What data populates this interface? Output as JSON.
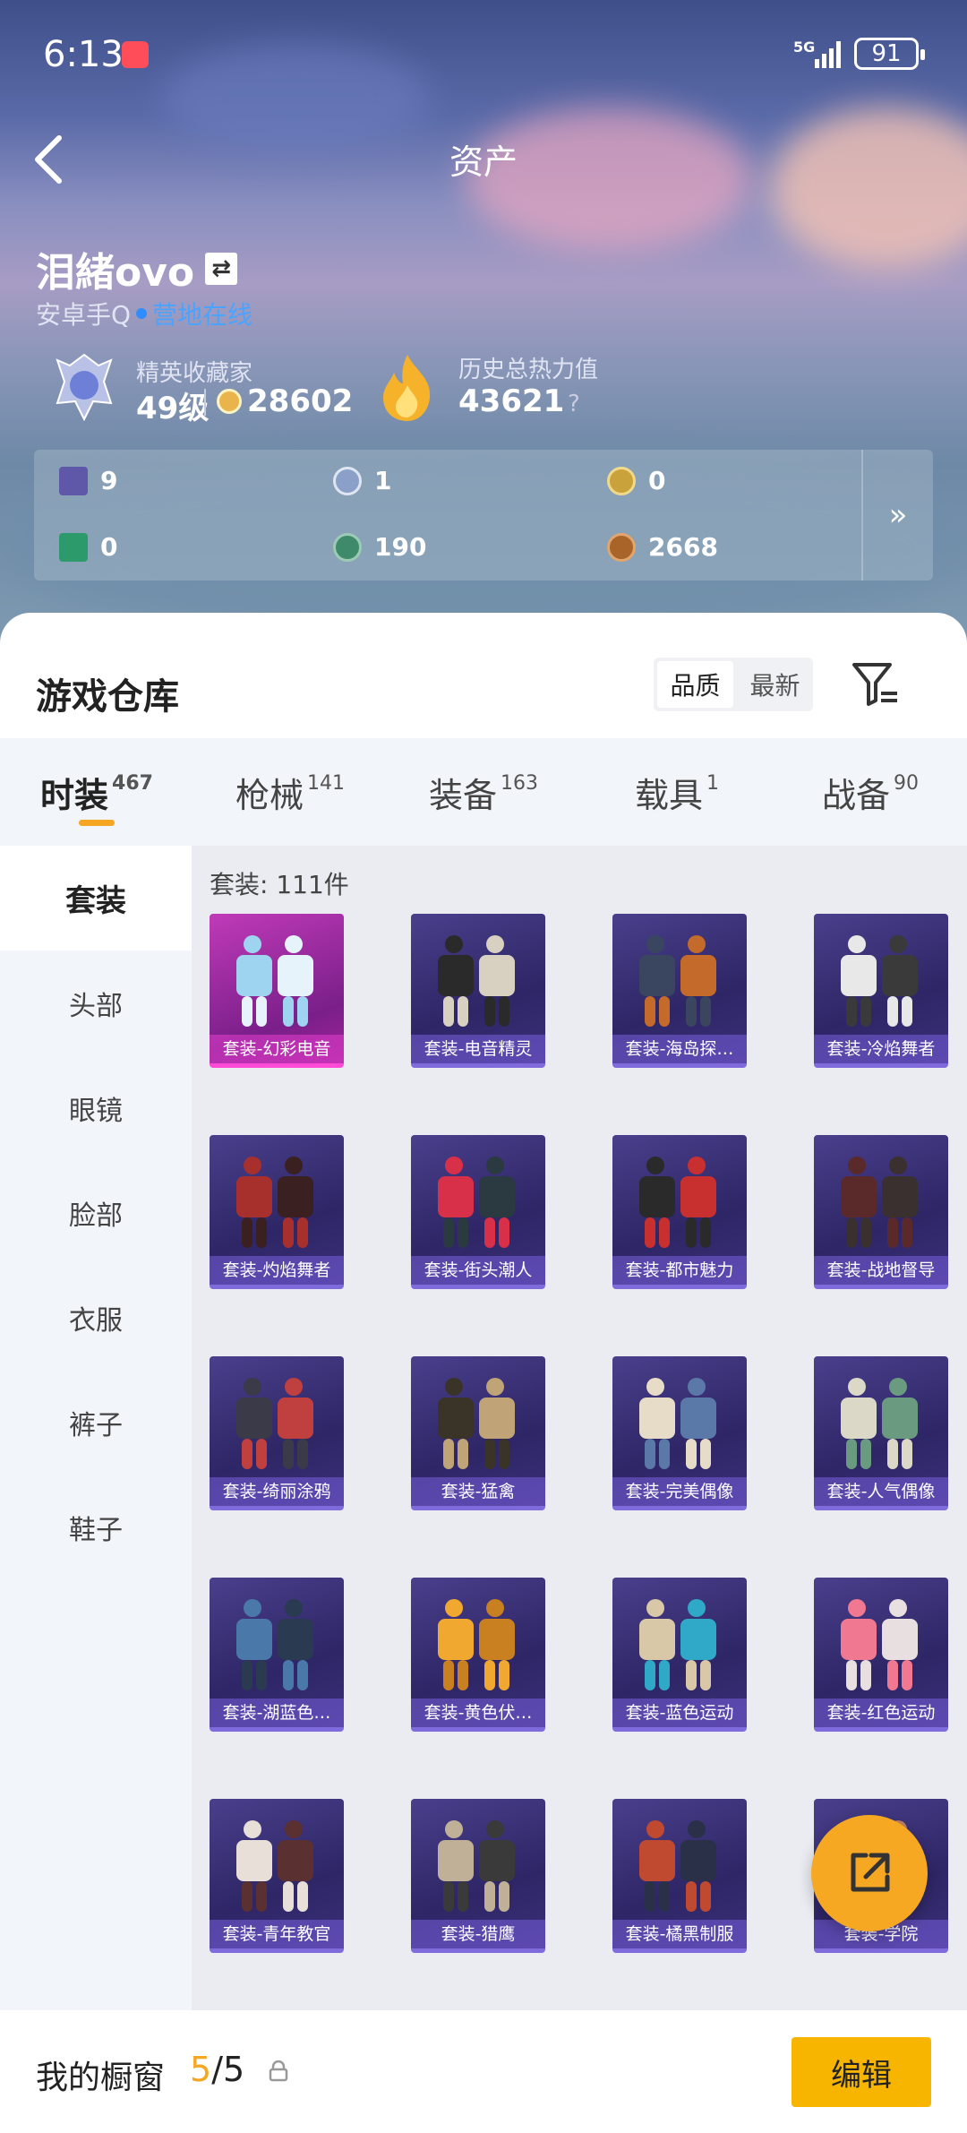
{
  "status": {
    "time": "6:13",
    "network": "5G",
    "battery": "91"
  },
  "header": {
    "title": "资产"
  },
  "user": {
    "name": "泪緒ovo",
    "platform": "安卓手Q",
    "status": "营地在线"
  },
  "stats": {
    "rank_label": "精英收藏家",
    "level": "49级",
    "coins": "28602",
    "heat_label": "历史总热力值",
    "heat_value": "43621",
    "help": "?"
  },
  "assets": [
    {
      "icon": "purple-card-icon",
      "value": "9"
    },
    {
      "icon": "silver-medal-icon",
      "value": "1"
    },
    {
      "icon": "gold-medal-icon",
      "value": "0"
    },
    {
      "icon": "green-card-icon",
      "value": "0"
    },
    {
      "icon": "green-orb-icon",
      "value": "190"
    },
    {
      "icon": "bronze-coin-icon",
      "value": "2668"
    }
  ],
  "warehouse": {
    "title": "游戏仓库",
    "sort": [
      "品质",
      "最新"
    ]
  },
  "tabs": [
    {
      "label": "时装",
      "count": "467"
    },
    {
      "label": "枪械",
      "count": "141"
    },
    {
      "label": "装备",
      "count": "163"
    },
    {
      "label": "载具",
      "count": "1"
    },
    {
      "label": "战备",
      "count": "90"
    }
  ],
  "sidebar": [
    "套装",
    "头部",
    "眼镜",
    "脸部",
    "衣服",
    "裤子",
    "鞋子"
  ],
  "grid": {
    "count_label": "套装: 111件",
    "items": [
      "套装-幻彩电音",
      "套装-电音精灵",
      "套装-海岛探…",
      "套装-冷焰舞者",
      "套装-灼焰舞者",
      "套装-街头潮人",
      "套装-都市魅力",
      "套装-战地督导",
      "套装-绮丽涂鸦",
      "套装-猛禽",
      "套装-完美偶像",
      "套装-人气偶像",
      "套装-湖蓝色…",
      "套装-黄色伏…",
      "套装-蓝色运动",
      "套装-红色运动",
      "套装-青年教官",
      "套装-猎鹰",
      "套装-橘黑制服",
      "套装-学院"
    ]
  },
  "bottom": {
    "label": "我的橱窗",
    "count_current": "5",
    "count_total": "/5",
    "edit": "编辑"
  },
  "colors": {
    "accent": "#f7b500",
    "tab_indicator": "#f5a623",
    "online": "#2f8dff"
  }
}
